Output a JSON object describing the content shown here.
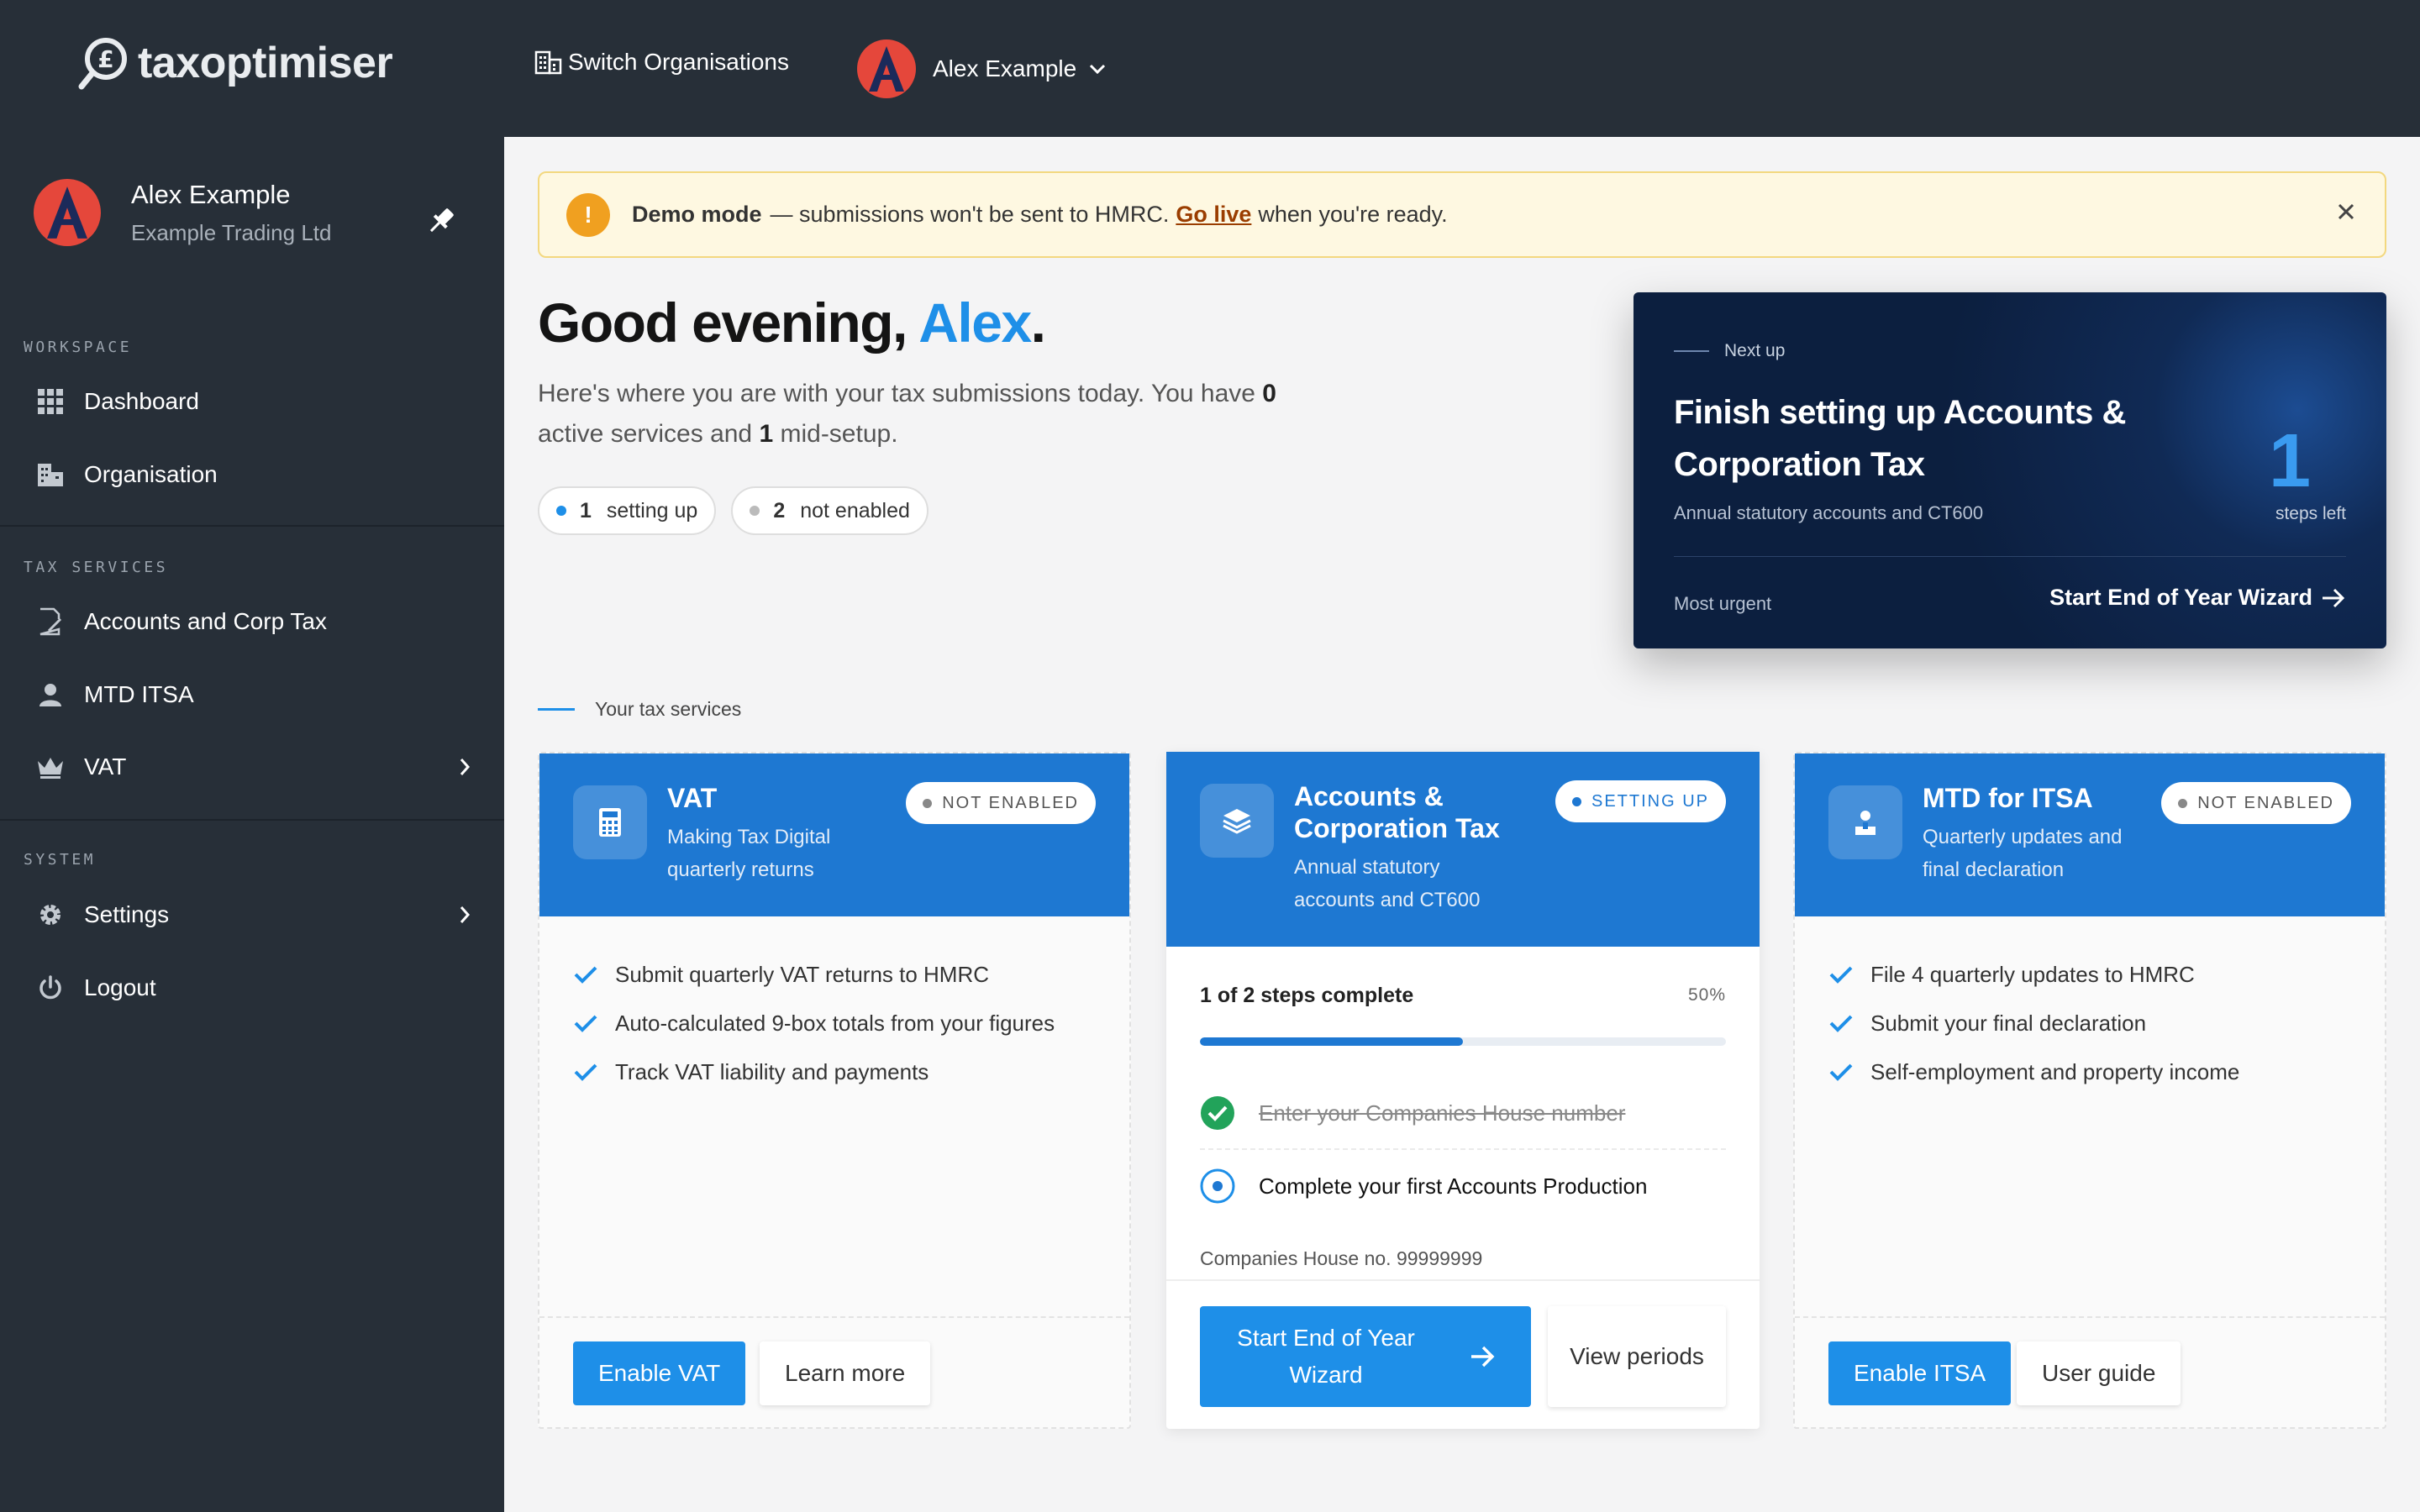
{
  "app": {
    "logo_text": "taxoptimiser"
  },
  "topbar": {
    "switch_org": "Switch Organisations",
    "user_name": "Alex Example"
  },
  "sidebar": {
    "user_name": "Alex Example",
    "org_name": "Example Trading Ltd",
    "sections": {
      "workspace": "WORKSPACE",
      "tax": "TAX SERVICES",
      "system": "SYSTEM"
    },
    "items": [
      {
        "label": "Dashboard",
        "icon": "grid-icon"
      },
      {
        "label": "Organisation",
        "icon": "building-icon"
      },
      {
        "label": "Accounts and Corp Tax",
        "icon": "document-edit-icon"
      },
      {
        "label": "MTD ITSA",
        "icon": "person-icon"
      },
      {
        "label": "VAT",
        "icon": "crown-icon"
      },
      {
        "label": "Settings",
        "icon": "gear-icon"
      },
      {
        "label": "Logout",
        "icon": "power-icon"
      }
    ]
  },
  "banner": {
    "strong": "Demo mode",
    "text1": "— submissions won't be sent to HMRC.",
    "link": "Go live",
    "text2": "when you're ready."
  },
  "greeting": {
    "prefix": "Good evening, ",
    "name": "Alex",
    "suffix": "."
  },
  "intro": {
    "t1": "Here's where you are with your tax submissions today. You have ",
    "n1": "0",
    "t2": " active services and ",
    "n2": "1",
    "t3": " mid-setup."
  },
  "chips": [
    {
      "count": "1",
      "label": "setting up",
      "color": "#1e8fe8"
    },
    {
      "count": "2",
      "label": "not enabled",
      "color": "#bbbbbb"
    }
  ],
  "next_up": {
    "label": "Next up",
    "title": "Finish setting up Accounts & Corporation Tax",
    "subtitle": "Annual statutory accounts and CT600",
    "steps_count": "1",
    "steps_label": "steps left",
    "urgency": "Most urgent",
    "cta": "Start End of Year Wizard"
  },
  "services_label": "Your tax services",
  "cards": {
    "vat": {
      "title": "VAT",
      "subtitle": "Making Tax Digital quarterly returns",
      "badge": "NOT ENABLED",
      "features": [
        "Submit quarterly VAT returns to HMRC",
        "Auto-calculated 9-box totals from your figures",
        "Track VAT liability and payments"
      ],
      "primary": "Enable VAT",
      "secondary": "Learn more"
    },
    "act": {
      "title": "Accounts & Corporation Tax",
      "subtitle": "Annual statutory accounts and CT600",
      "badge": "SETTING UP",
      "progress_label": "1 of 2 steps complete",
      "progress_pct": "50%",
      "progress": 0.5,
      "steps": [
        "Enter your Companies House number",
        "Complete your first Accounts Production"
      ],
      "companies_house": "Companies House no. 99999999",
      "primary": "Start End of Year Wizard",
      "secondary": "View periods"
    },
    "itsa": {
      "title": "MTD for ITSA",
      "subtitle": "Quarterly updates and final declaration",
      "badge": "NOT ENABLED",
      "features": [
        "File 4 quarterly updates to HMRC",
        "Submit your final declaration",
        "Self-employment and property income"
      ],
      "primary": "Enable ITSA",
      "secondary": "User guide"
    }
  }
}
